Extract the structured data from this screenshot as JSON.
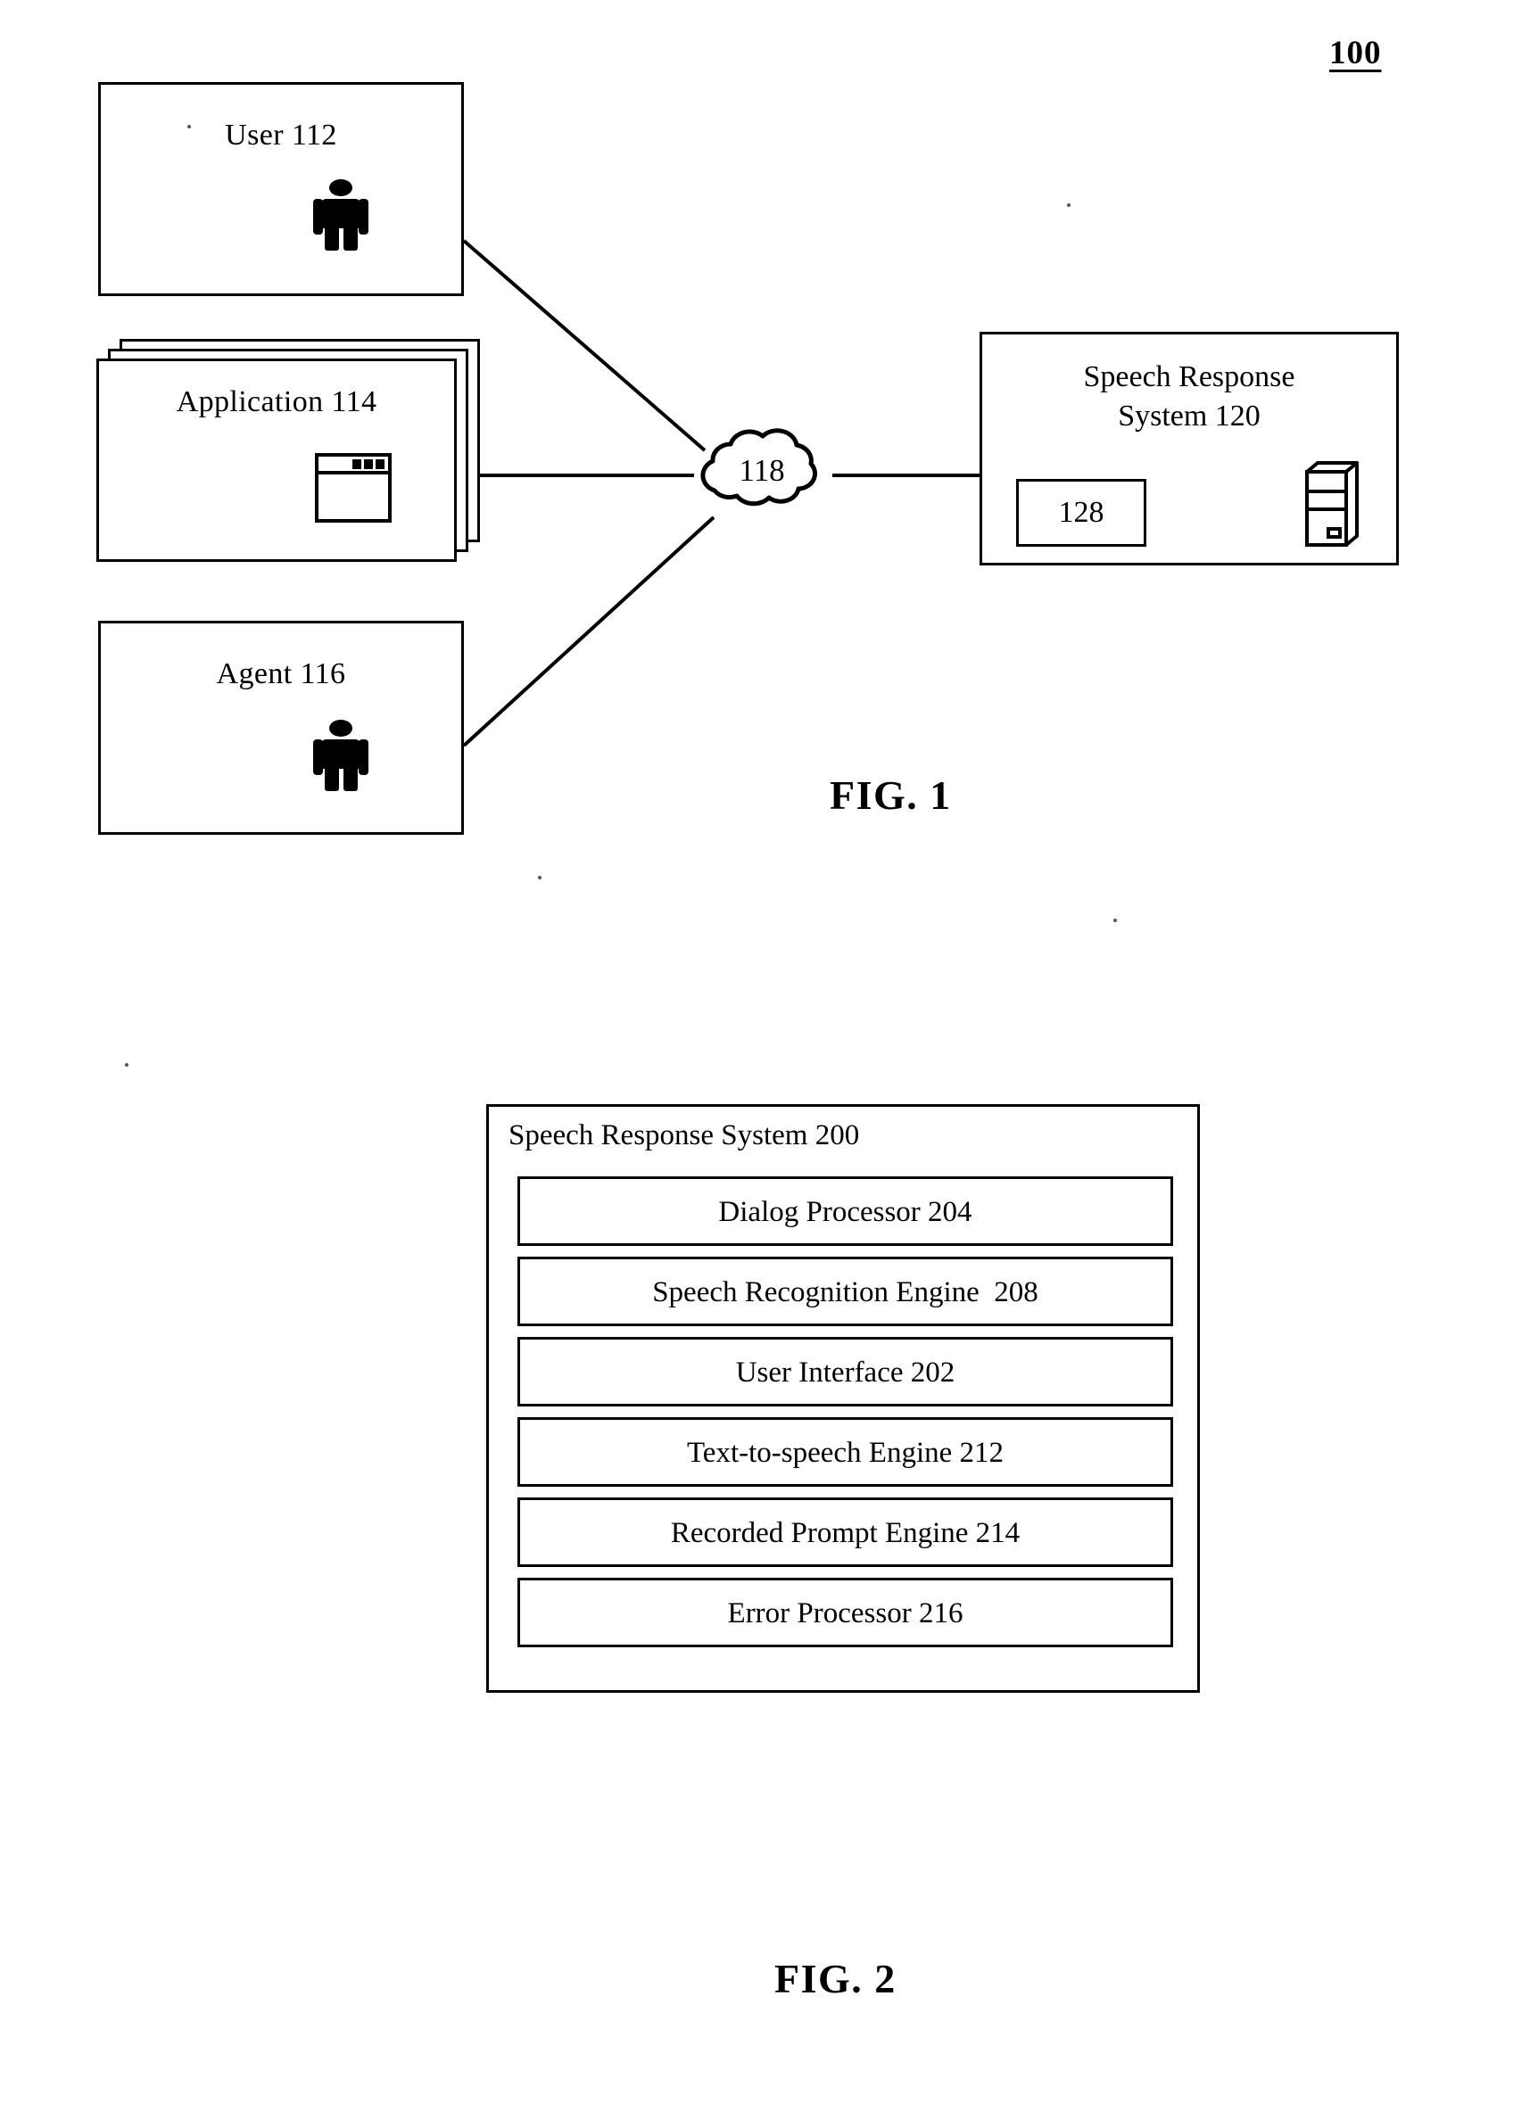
{
  "figure1": {
    "reference_numeral": "100",
    "caption": "FIG. 1",
    "nodes": {
      "user": {
        "label": "User 112",
        "icon": "person-icon"
      },
      "application": {
        "label": "Application 114",
        "icon": "window-icon"
      },
      "agent": {
        "label": "Agent 116",
        "icon": "person-icon"
      },
      "network": {
        "label": "118",
        "icon": "cloud-icon"
      },
      "speech_response_system": {
        "title_line1": "Speech Response",
        "title_line2": "System 120",
        "inner_box_label": "128",
        "icon": "server-tower-icon"
      }
    },
    "connections": [
      {
        "from": "user",
        "to": "network"
      },
      {
        "from": "application",
        "to": "network"
      },
      {
        "from": "agent",
        "to": "network"
      },
      {
        "from": "network",
        "to": "speech_response_system"
      }
    ]
  },
  "figure2": {
    "caption": "FIG. 2",
    "container_title": "Speech Response System 200",
    "modules": [
      {
        "label": "Dialog Processor 204"
      },
      {
        "label": "Speech Recognition Engine  208"
      },
      {
        "label": "User Interface 202"
      },
      {
        "label": "Text-to-speech Engine 212"
      },
      {
        "label": "Recorded Prompt Engine 214"
      },
      {
        "label": "Error Processor 216"
      }
    ]
  },
  "colors": {
    "ink": "#000000",
    "paper": "#ffffff"
  }
}
